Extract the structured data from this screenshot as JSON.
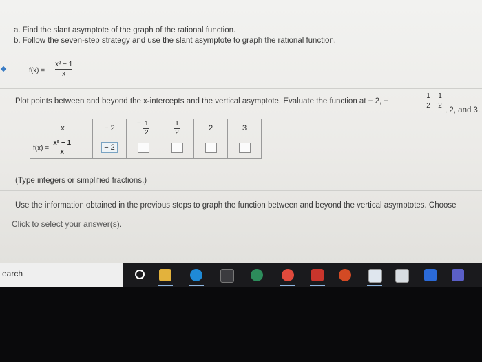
{
  "instructions": {
    "line_a": "a. Find the slant asymptote of the graph of the rational function.",
    "line_b": "b. Follow the seven-step strategy and use the slant asymptote to graph the rational function."
  },
  "function": {
    "lhs": "f(x) =",
    "numerator": "x² − 1",
    "denominator": "x"
  },
  "plot_prompt": {
    "text": "Plot points between and beyond the x-intercepts and the vertical asymptote. Evaluate the function at",
    "values_start": "− 2, −",
    "frac_num": "1",
    "frac_den": "2",
    "frac2_num": "1",
    "frac2_den": "2",
    "values_end": ", 2, and 3."
  },
  "table": {
    "x_label": "x",
    "fx_lhs": "f(x) =",
    "fx_num": "x² − 1",
    "fx_den": "x",
    "x_values": [
      "− 2",
      "1",
      "1",
      "2",
      "3"
    ],
    "neg_sign": "−",
    "frac_den": "2",
    "answer_first": "− 2"
  },
  "note": "(Type integers or simplified fractions.)",
  "use_info": "Use the information obtained in the previous steps to graph the function between and beyond the vertical asymptotes. Choose",
  "click_prompt": "Click to select your answer(s).",
  "taskbar": {
    "search_text": "earch"
  },
  "colors": {
    "screen_bg": "#efeeeb",
    "taskbar_bg": "#1a1a1d",
    "link_blue": "#1b5fa8"
  }
}
